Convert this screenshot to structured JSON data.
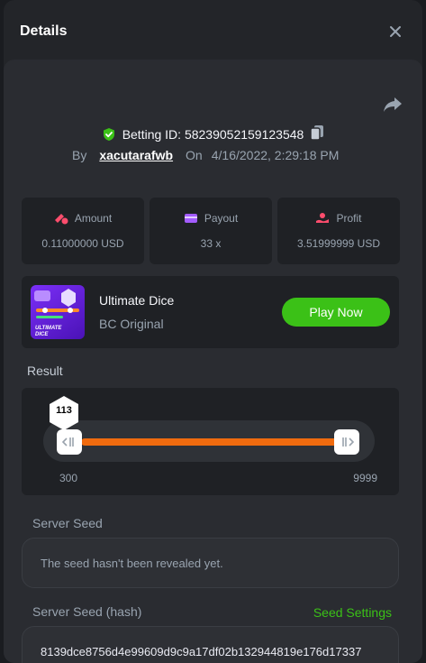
{
  "modal": {
    "title": "Details"
  },
  "bet": {
    "id_text": "Betting ID: 58239052159123548",
    "by_label": "By",
    "username": "xacutarafwb",
    "on_label": "On",
    "date": "4/16/2022, 2:29:18 PM"
  },
  "stats": [
    {
      "label": "Amount",
      "value": "0.11000000 USD",
      "icon": "amount-icon",
      "color": "#ff4d6d"
    },
    {
      "label": "Payout",
      "value": "33 x",
      "icon": "payout-icon",
      "color": "#a35cff"
    },
    {
      "label": "Profit",
      "value": "3.51999999 USD",
      "icon": "profit-icon",
      "color": "#ff4d6d"
    }
  ],
  "game": {
    "name": "Ultimate Dice",
    "provider": "BC Original",
    "play_label": "Play Now",
    "thumb_text": "ULTIMATE DICE"
  },
  "result": {
    "label": "Result",
    "value": "113",
    "min": "300",
    "max": "9999"
  },
  "server_seed": {
    "label": "Server Seed",
    "value": "The seed hasn't been revealed yet."
  },
  "server_seed_hash": {
    "label": "Server Seed (hash)",
    "settings_label": "Seed Settings",
    "value": "8139dce8756d4e99609d9c9a17df02b132944819e176d17337"
  },
  "colors": {
    "accent_green": "#3bc117",
    "slider_orange": "#f06b0f",
    "verified_green": "#3bc117"
  }
}
